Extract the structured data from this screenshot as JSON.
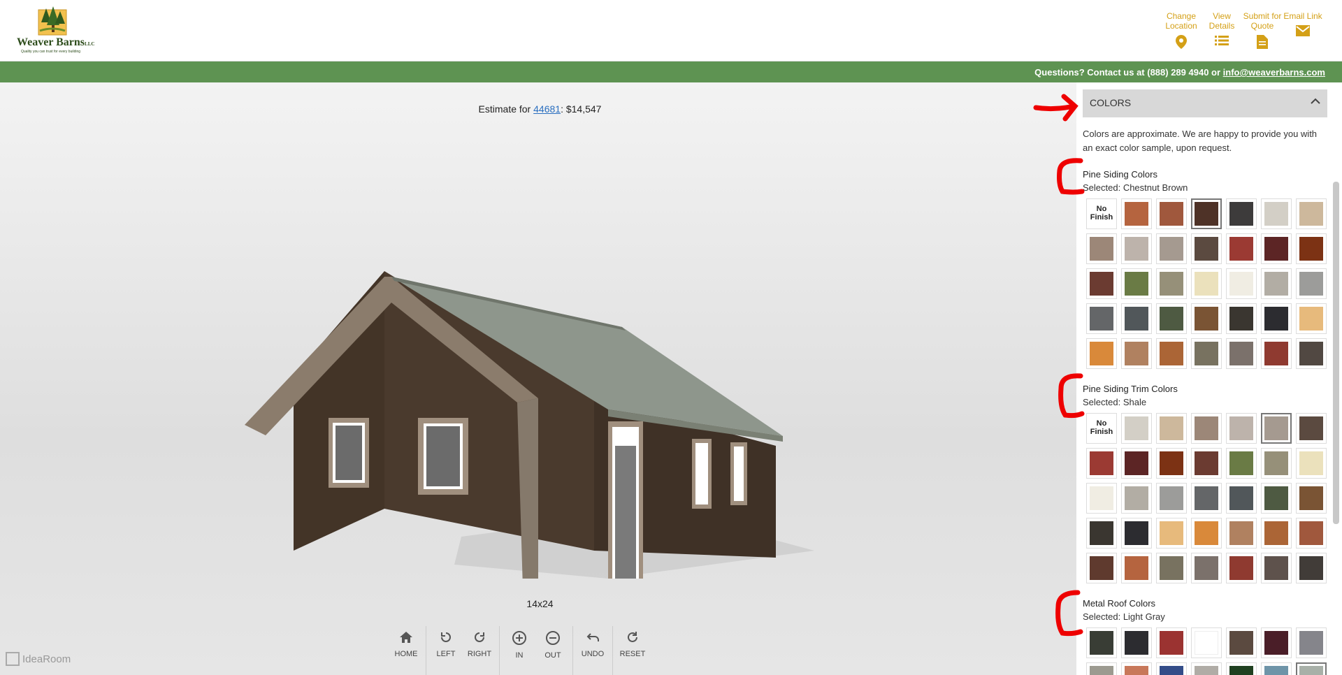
{
  "header": {
    "logo_name": "Weaver Barns",
    "logo_mark": "LLC",
    "logo_tagline": "Quality you can trust for every building",
    "buttons": [
      {
        "label": "Change Location",
        "icon": "location-pin-icon"
      },
      {
        "label": "View Details",
        "icon": "list-icon"
      },
      {
        "label": "Submit for Quote",
        "icon": "document-icon"
      },
      {
        "label": "Email Link",
        "icon": "envelope-icon"
      }
    ],
    "accent": "#d4a017"
  },
  "contact": {
    "text": "Questions? Contact us at (888) 289 4940 or ",
    "email": "info@weaverbarns.com",
    "bar_color": "#5e9352"
  },
  "viewer": {
    "estimate_prefix": "Estimate for ",
    "zip": "44681",
    "estimate_suffix": ": $14,547",
    "size_label": "14x24",
    "controls": [
      {
        "label": "HOME",
        "icon": "home-icon"
      },
      {
        "label": "LEFT",
        "icon": "rotate-left-icon"
      },
      {
        "label": "RIGHT",
        "icon": "rotate-right-icon"
      },
      {
        "label": "IN",
        "icon": "zoom-in-icon"
      },
      {
        "label": "OUT",
        "icon": "zoom-out-icon"
      },
      {
        "label": "UNDO",
        "icon": "undo-icon"
      },
      {
        "label": "RESET",
        "icon": "reset-icon"
      }
    ],
    "brand": "IdeaRoom"
  },
  "panel": {
    "section_title": "COLORS",
    "intro": "Colors are approximate. We are happy to provide you with an exact color sample, upon request.",
    "no_finish_label": "No Finish",
    "groups": [
      {
        "title": "Pine Siding Colors",
        "selected": "Selected: Chestnut Brown",
        "swatches": [
          "nofinish",
          "#b5643f",
          "#a0583d",
          "#4e3227",
          "#3d3b3b",
          "#d3cfc6",
          "#cdb89c",
          "#9c8778",
          "#bdb3ab",
          "#a59a90",
          "#5b4a40",
          "#9b3a33",
          "#5c2525",
          "#7c3214",
          "#6b3b31",
          "#6a7b45",
          "#969079",
          "#ebe1bc",
          "#f0ede3",
          "#b2ada4",
          "#9c9c9a",
          "#646668",
          "#51575a",
          "#4e5a42",
          "#7a5434",
          "#3a3630",
          "#2c2c30",
          "#e7ba7c",
          "#d9893a",
          "#b08160",
          "#ab6536",
          "#787260",
          "#7b716b",
          "#8f3a30",
          "#514842"
        ],
        "selected_index": 3
      },
      {
        "title": "Pine Siding Trim Colors",
        "selected": "Selected: Shale",
        "swatches": [
          "nofinish",
          "#d3cfc6",
          "#cdb89c",
          "#9c8778",
          "#bdb3ab",
          "#a59a90",
          "#5b4a40",
          "#9b3a33",
          "#5c2525",
          "#7c3214",
          "#6b3b31",
          "#6a7b45",
          "#969079",
          "#ebe1bc",
          "#f0ede3",
          "#b2ada4",
          "#9c9c9a",
          "#646668",
          "#51575a",
          "#4e5a42",
          "#7a5434",
          "#3a3630",
          "#2c2c30",
          "#e7ba7c",
          "#d9893a",
          "#b08160",
          "#ab6536",
          "#a0583d",
          "#5f3a2e",
          "#b5643f",
          "#787260",
          "#7b716b",
          "#8f3a30",
          "#5e524c",
          "#413c38"
        ],
        "selected_index": 5
      },
      {
        "title": "Metal Roof Colors",
        "selected": "Selected: Light Gray",
        "swatches": [
          "#393d35",
          "#2c2c30",
          "#9b3331",
          "#ffffff",
          "#5b4a40",
          "#4a1e28",
          "#85858b",
          "#9c9a90",
          "#c8785a",
          "#334c88",
          "#b0aca6",
          "#1f4020",
          "#6e94a8",
          "#a8b0a8"
        ],
        "selected_index": 13
      }
    ]
  }
}
